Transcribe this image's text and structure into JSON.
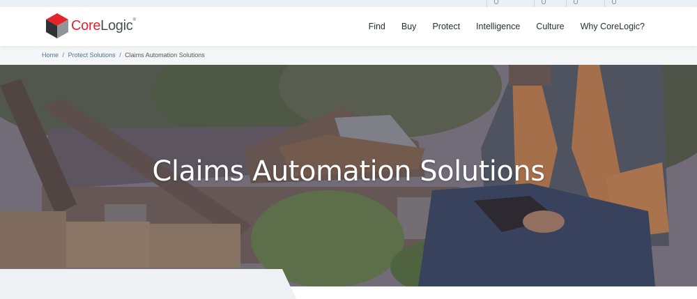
{
  "brand": {
    "name_part1": "Core",
    "name_part2": "Logic",
    "registered": "®",
    "logo_icon": "corelogic-cube-icon",
    "colors": {
      "red": "#e4232b",
      "gray": "#4b4f54",
      "dark": "#3a3d40"
    }
  },
  "nav": {
    "items": [
      "Find",
      "Buy",
      "Protect",
      "Intelligence",
      "Culture",
      "Why CoreLogic?"
    ]
  },
  "breadcrumb": {
    "home": "Home",
    "section": "Protect Solutions",
    "current": "Claims Automation Solutions",
    "separator": "/"
  },
  "hero": {
    "title": "Claims Automation Solutions"
  },
  "utility": {
    "icons": [
      "support-icon",
      "globe-icon",
      "contact-icon",
      "login-icon"
    ]
  }
}
